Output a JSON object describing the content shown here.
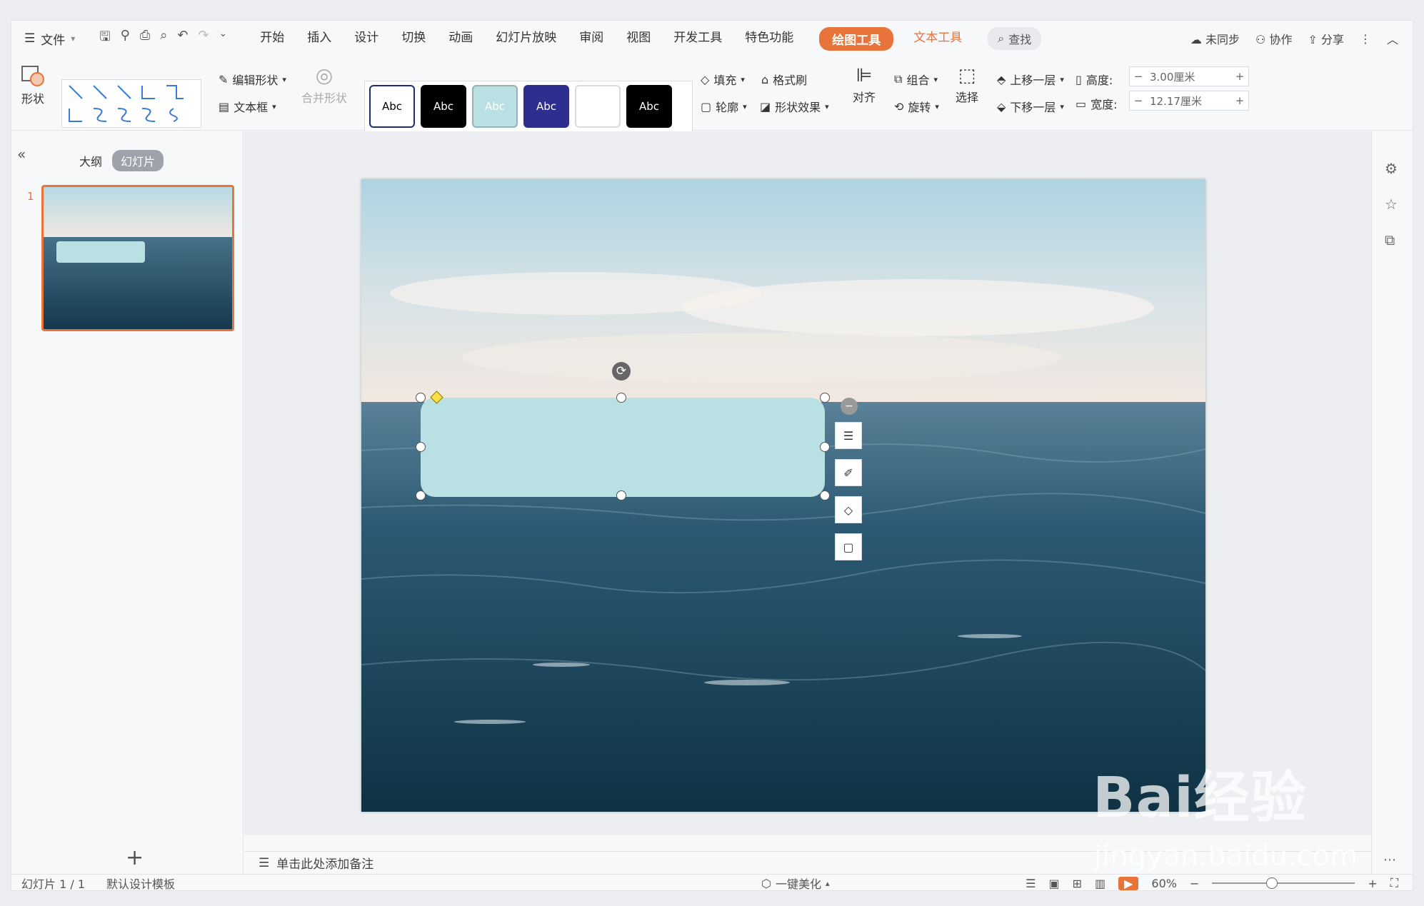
{
  "menu": {
    "file_label": "文件",
    "tabs": [
      "开始",
      "插入",
      "设计",
      "切换",
      "动画",
      "幻灯片放映",
      "审阅",
      "视图",
      "开发工具",
      "特色功能"
    ],
    "context_tabs": [
      "绘图工具",
      "文本工具"
    ],
    "search_label": "查找",
    "right": {
      "sync": "未同步",
      "collab": "协作",
      "share": "分享"
    }
  },
  "ribbon": {
    "shape_label": "形状",
    "edit_shape": "编辑形状",
    "text_box": "文本框",
    "merge_shape": "合并形状",
    "style_swatches": [
      {
        "label": "Abc",
        "bg": "#ffffff",
        "fg": "#000000",
        "border": "#1f2a7a"
      },
      {
        "label": "Abc",
        "bg": "#000000",
        "fg": "#ffffff",
        "border": "#000000"
      },
      {
        "label": "Abc",
        "bg": "#b9e0e3",
        "fg": "#ffffff",
        "border": "#9bb0b3"
      },
      {
        "label": "Abc",
        "bg": "#2e2e8f",
        "fg": "#ffffff",
        "border": "#2e2e8f"
      },
      {
        "label": "",
        "bg": "#ffffff",
        "fg": "#000000",
        "border": "#d8dbe0"
      },
      {
        "label": "Abc",
        "bg": "#000000",
        "fg": "#ffffff",
        "border": "#000000"
      }
    ],
    "fill": "填充",
    "format_brush": "格式刷",
    "outline": "轮廓",
    "shape_effect": "形状效果",
    "align": "对齐",
    "group": "组合",
    "rotate": "旋转",
    "select": "选择",
    "bring_forward": "上移一层",
    "send_backward": "下移一层",
    "height_label": "高度:",
    "height_value": "3.00厘米",
    "width_label": "宽度:",
    "width_value": "12.17厘米"
  },
  "left_panel": {
    "tab_outline": "大纲",
    "tab_slides": "幻灯片",
    "slide_number": "1"
  },
  "notes_placeholder": "单击此处添加备注",
  "status": {
    "slide_info": "幻灯片 1 / 1",
    "template": "默认设计模板",
    "beautify": "一键美化",
    "zoom": "60%"
  },
  "watermark": {
    "brand": "Bai经验",
    "url": "jingyan.baidu.com"
  },
  "colors": {
    "accent": "#e8743b",
    "shape_fill": "#b9e0e3"
  }
}
